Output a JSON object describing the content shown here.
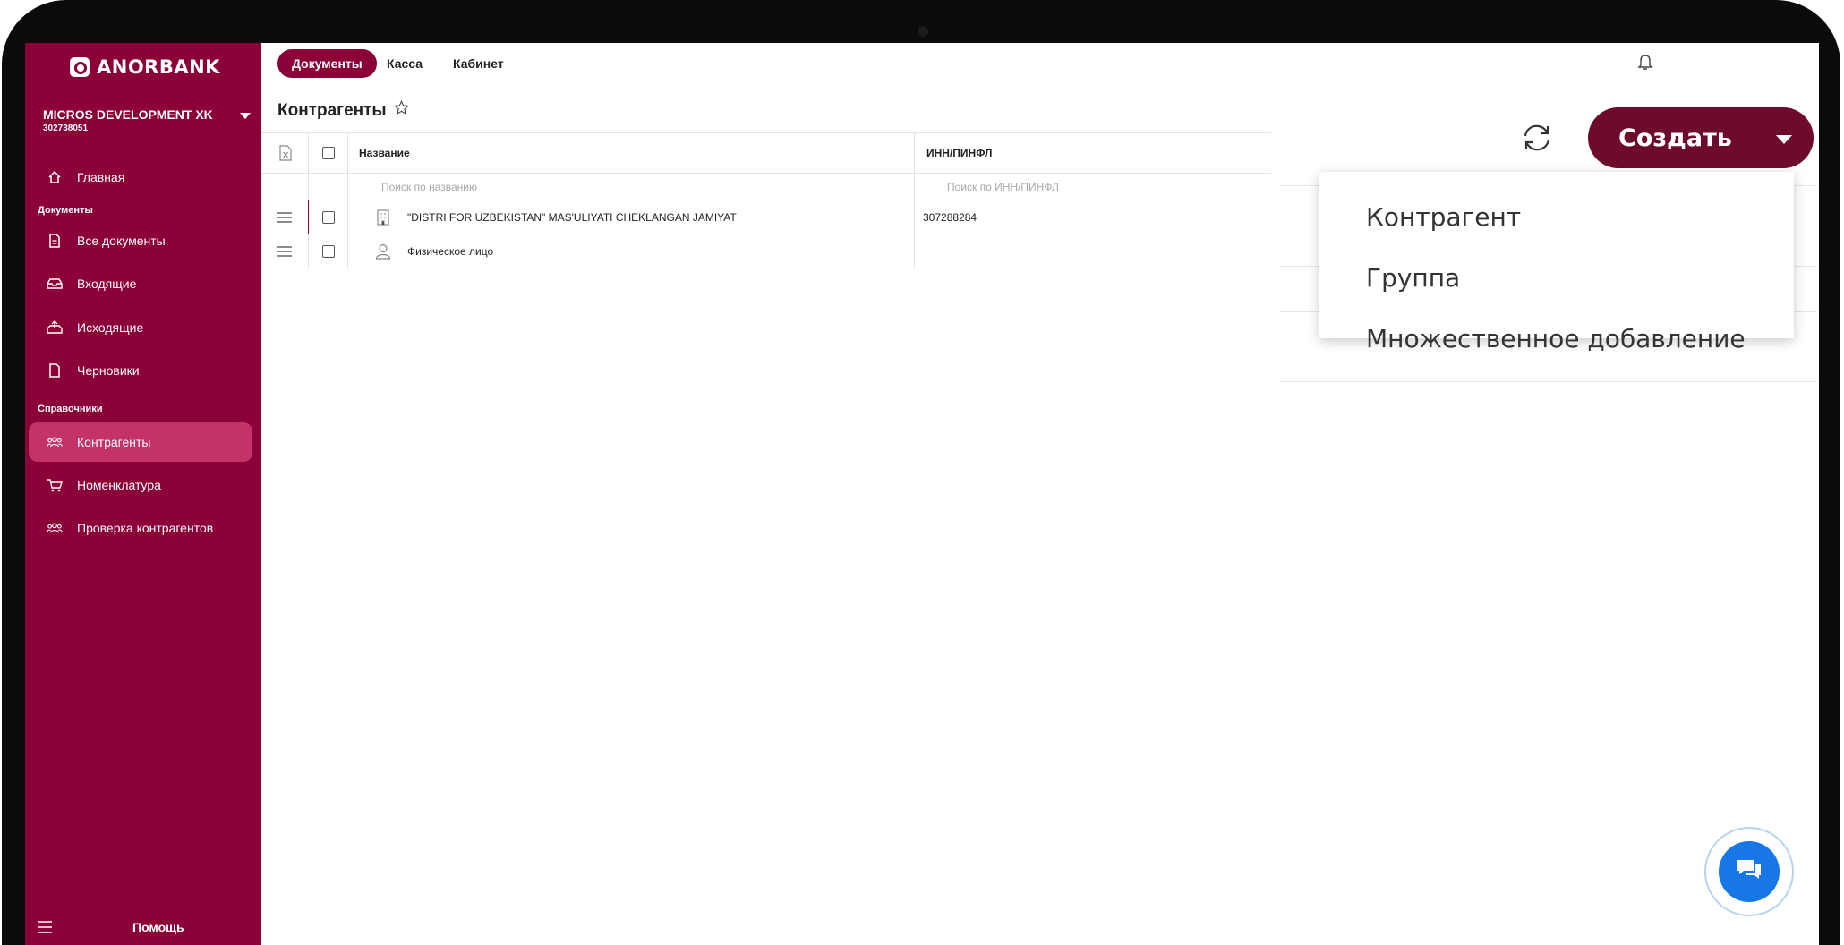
{
  "brand": {
    "logo_text": "ANORBANK",
    "primary_color": "#8b0037",
    "active_color": "#c4326a",
    "create_color": "#6d0a2d",
    "chat_color": "#1877e6"
  },
  "company": {
    "name": "MICROS DEVELOPMENT XK",
    "id": "302738051"
  },
  "sidebar": {
    "items": [
      {
        "label": "Главная",
        "icon": "home-icon"
      },
      {
        "label": "Все документы",
        "icon": "document-icon"
      },
      {
        "label": "Входящие",
        "icon": "inbox-icon"
      },
      {
        "label": "Исходящие",
        "icon": "outbox-icon"
      },
      {
        "label": "Черновики",
        "icon": "draft-icon"
      },
      {
        "label": "Контрагенты",
        "icon": "users-icon",
        "active": true
      },
      {
        "label": "Номенклатура",
        "icon": "cart-icon"
      },
      {
        "label": "Проверка контрагентов",
        "icon": "users-icon"
      }
    ],
    "sections": [
      "Документы",
      "Справочники"
    ],
    "help_label": "Помощь"
  },
  "topbar": {
    "tabs": [
      "Документы",
      "Касса",
      "Кабинет"
    ],
    "active_tab": "Документы"
  },
  "page": {
    "title": "Контрагенты"
  },
  "table": {
    "columns": [
      "Название",
      "ИНН/ПИНФЛ"
    ],
    "filters": {
      "name_placeholder": "Поиск по названию",
      "inn_placeholder": "Поиск по ИНН/ПИНФЛ"
    },
    "rows": [
      {
        "name": "\"DISTRI FOR UZBEKISTAN\" MAS'ULIYATI CHEKLANGAN JAMIYAT",
        "inn": "307288284",
        "type_icon": "building-icon"
      },
      {
        "name": "Физическое лицо",
        "inn": "",
        "type_icon": "person-icon"
      }
    ]
  },
  "actions": {
    "create_label": "Создать"
  },
  "dropdown": {
    "items": [
      "Контрагент",
      "Группа",
      "Множественное добавление"
    ]
  }
}
